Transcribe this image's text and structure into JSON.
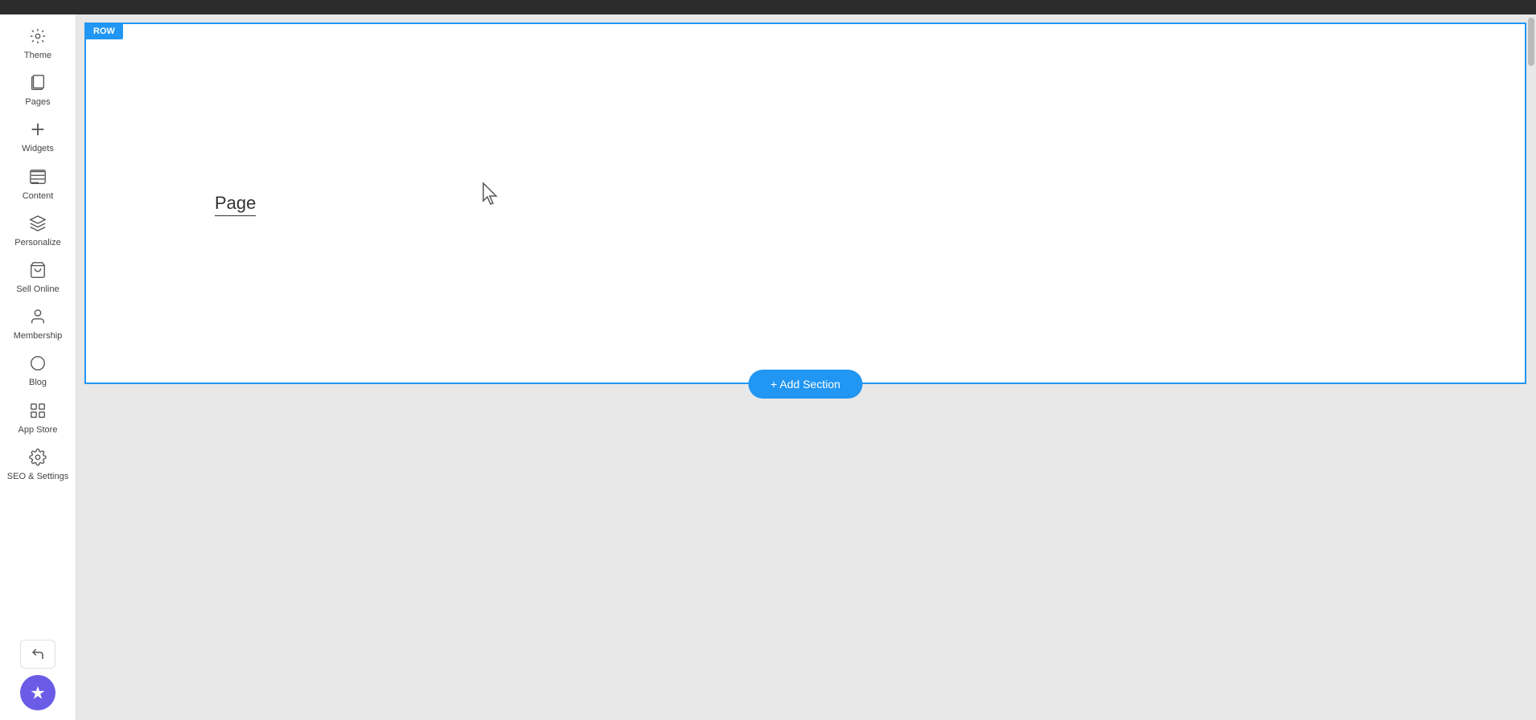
{
  "topbar": {},
  "sidebar": {
    "items": [
      {
        "id": "theme",
        "label": "Theme",
        "icon": "◈"
      },
      {
        "id": "pages",
        "label": "Pages",
        "icon": "⧉"
      },
      {
        "id": "widgets",
        "label": "Widgets",
        "icon": "+"
      },
      {
        "id": "content",
        "label": "Content",
        "icon": "⊡"
      },
      {
        "id": "personalize",
        "label": "Personalize",
        "icon": "⤢"
      },
      {
        "id": "sell-online",
        "label": "Sell Online",
        "icon": "🛒"
      },
      {
        "id": "membership",
        "label": "Membership",
        "icon": "👤"
      },
      {
        "id": "blog",
        "label": "Blog",
        "icon": "◯"
      },
      {
        "id": "app-store",
        "label": "App Store",
        "icon": "◈"
      },
      {
        "id": "seo-settings",
        "label": "SEO & Settings",
        "icon": "⚙"
      }
    ],
    "undo_icon": "↩",
    "magic_icon": "✦"
  },
  "canvas": {
    "row_badge": "ROW",
    "page_label": "Page",
    "add_section_label": "+ Add Section"
  }
}
